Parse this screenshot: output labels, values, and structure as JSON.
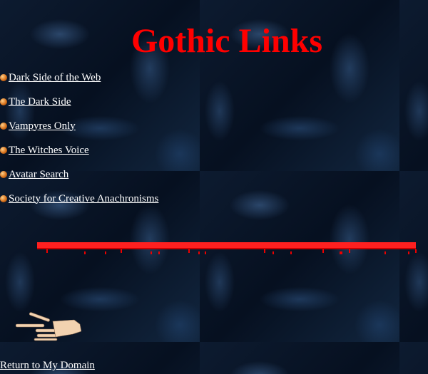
{
  "title": "Gothic Links",
  "links": [
    {
      "label": "Dark Side of the Web"
    },
    {
      "label": "The Dark Side"
    },
    {
      "label": "Vampyres Only"
    },
    {
      "label": "The Witches Voice"
    },
    {
      "label": "Avatar Search"
    },
    {
      "label": "Society for Creative Anachronisms"
    }
  ],
  "return_link": "Return to My Domain",
  "colors": {
    "title": "#ff0000",
    "link": "#ffffff",
    "blood": "#ff2020"
  },
  "icons": {
    "bullet": "orange-ball-icon",
    "divider": "blood-drip-divider",
    "pointer": "skeleton-hand-icon"
  }
}
